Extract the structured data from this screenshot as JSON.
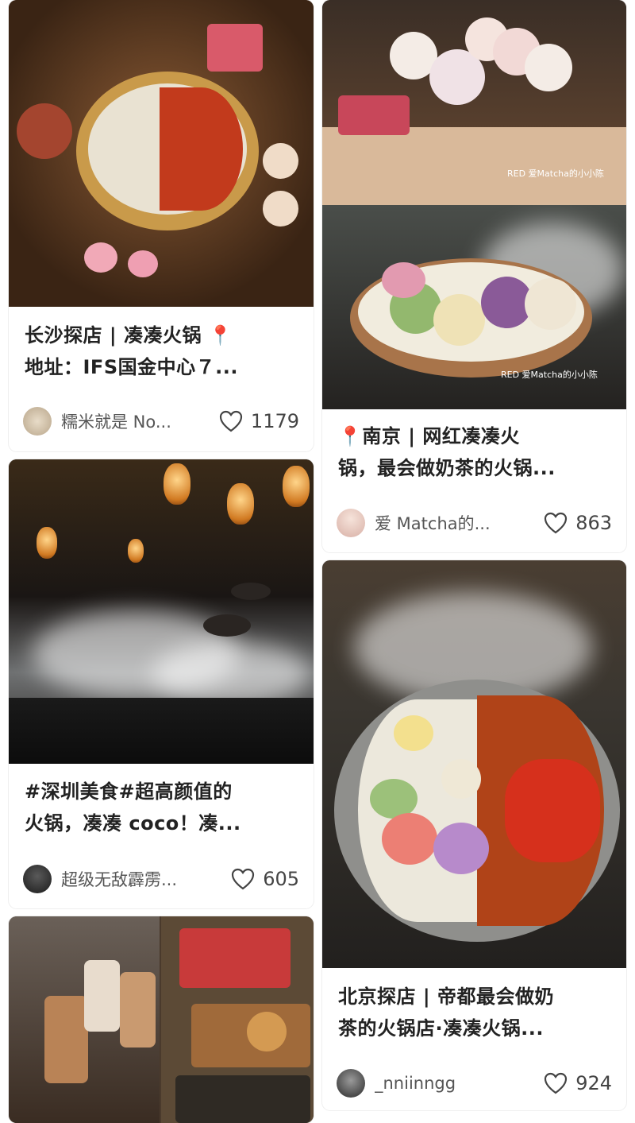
{
  "cards": [
    {
      "title_line1": "长沙探店 | 凑凑火锅 📍",
      "title_line2": "地址：IFS国金中心７...",
      "author": "糯米就是 No...",
      "likes": "1179"
    },
    {
      "cover_watermark_top": "RED 爱Matcha的小小陈",
      "cover_watermark_bottom": "RED 爱Matcha的小小陈",
      "title_line1": "📍南京 | 网红凑凑火",
      "title_line2": "锅，最会做奶茶的火锅...",
      "author": "爱 Matcha的...",
      "likes": "863"
    },
    {
      "title_line1": "#深圳美食#超高颜值的",
      "title_line2": "火锅，凑凑 coco！凑...",
      "author": "超级无敌霹雳...",
      "likes": "605"
    },
    {
      "title_line1": "北京探店 | 帝都最会做奶",
      "title_line2": "茶的火锅店·凑凑火锅...",
      "author": "_nniinngg",
      "likes": "924"
    },
    {
      "title_line1": "",
      "title_line2": "",
      "author": "",
      "likes": ""
    }
  ]
}
